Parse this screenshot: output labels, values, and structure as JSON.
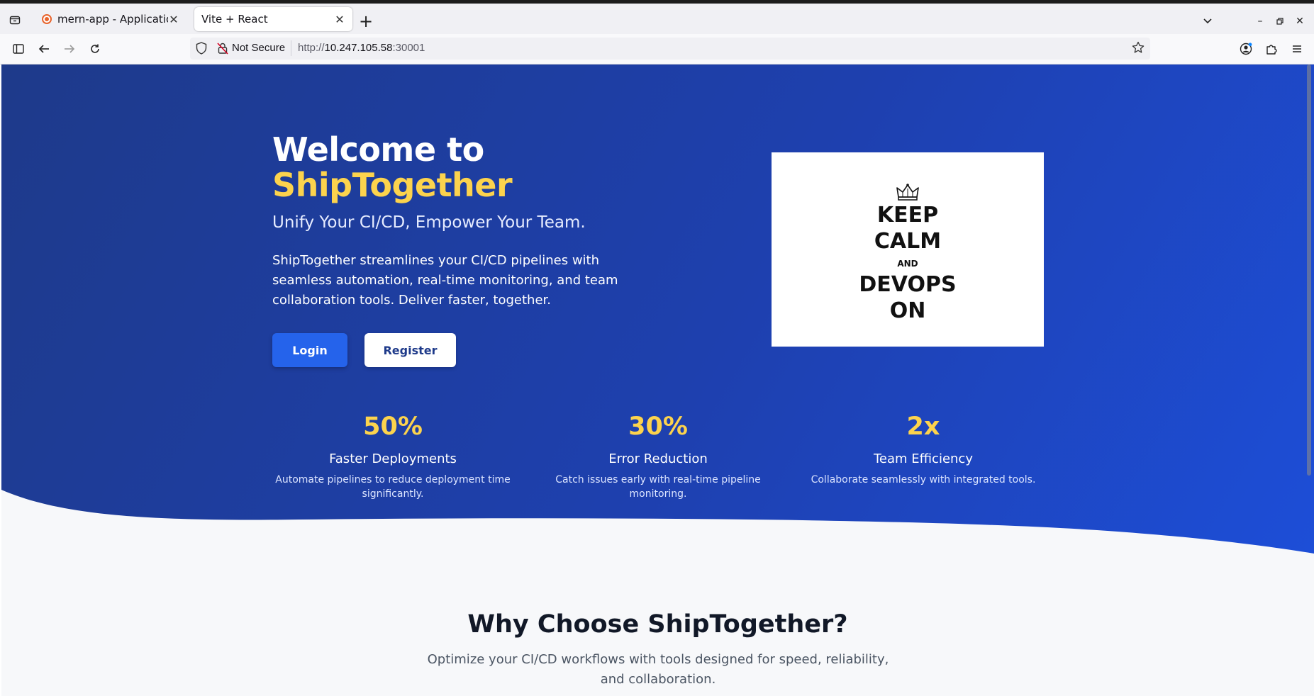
{
  "browser": {
    "tabs": [
      {
        "title": "mern-app - Application Dashboard",
        "active": false
      },
      {
        "title": "Vite + React",
        "active": true
      }
    ],
    "security_label": "Not Secure",
    "url_prefix": "http://",
    "url_host": "10.247.105.58",
    "url_port": ":30001"
  },
  "hero": {
    "title_line1": "Welcome to",
    "title_brand": "ShipTogether",
    "subtitle": "Unify Your CI/CD, Empower Your Team.",
    "description": "ShipTogether streamlines your CI/CD pipelines with seamless automation, real-time monitoring, and team collaboration tools. Deliver faster, together.",
    "login_label": "Login",
    "register_label": "Register",
    "poster": {
      "line1": "KEEP",
      "line2": "CALM",
      "line3": "AND",
      "line4": "DEVOPS",
      "line5": "ON"
    }
  },
  "stats": [
    {
      "value": "50%",
      "label": "Faster Deployments",
      "desc": "Automate pipelines to reduce deployment time significantly."
    },
    {
      "value": "30%",
      "label": "Error Reduction",
      "desc": "Catch issues early with real-time pipeline monitoring."
    },
    {
      "value": "2x",
      "label": "Team Efficiency",
      "desc": "Collaborate seamlessly with integrated tools."
    }
  ],
  "why": {
    "title": "Why Choose ShipTogether?",
    "description": "Optimize your CI/CD workflows with tools designed for speed, reliability, and collaboration."
  },
  "colors": {
    "hero_start": "#1e3a8a",
    "hero_end": "#1d4ed8",
    "accent_yellow": "#fcd34d",
    "login_button": "#2563eb",
    "section_bg": "#f7f8fa"
  },
  "icons": [
    "tab-overview-icon",
    "sidebar-icon",
    "back-icon",
    "forward-icon",
    "reload-icon",
    "shield-icon",
    "insecure-lock-icon",
    "bookmark-star-icon",
    "account-icon",
    "extensions-icon",
    "menu-icon",
    "crown-icon"
  ]
}
